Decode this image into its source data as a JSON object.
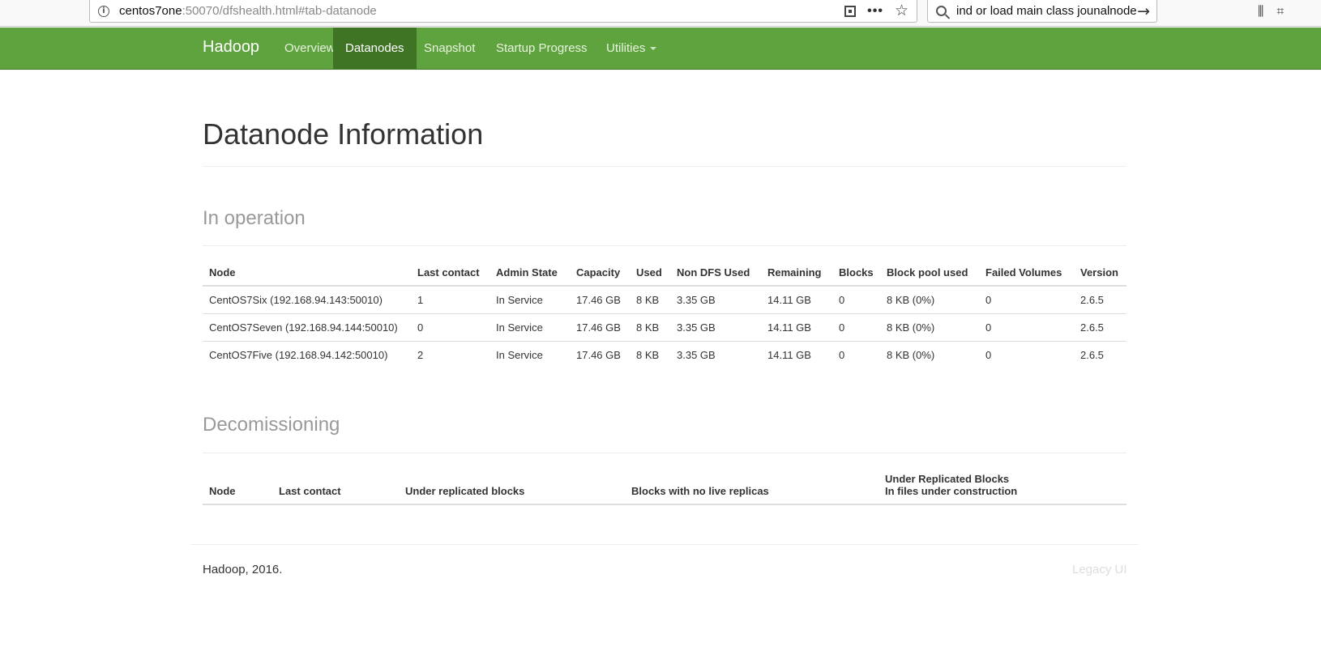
{
  "browser": {
    "url_host": "centos7one",
    "url_rest": ":50070/dfshealth.html#tab-datanode",
    "search_text": "ind or load main class jounalnode"
  },
  "navbar": {
    "brand": "Hadoop",
    "items": [
      {
        "label": "Overview",
        "active": false
      },
      {
        "label": "Datanodes",
        "active": true
      },
      {
        "label": "Snapshot",
        "active": false
      },
      {
        "label": "Startup Progress",
        "active": false
      },
      {
        "label": "Utilities",
        "active": false,
        "dropdown": true
      }
    ],
    "colors": {
      "bar": "#5fa33e",
      "active": "#3e7424"
    }
  },
  "page": {
    "title": "Datanode Information"
  },
  "in_operation": {
    "title": "In operation",
    "columns": [
      "Node",
      "Last contact",
      "Admin State",
      "Capacity",
      "Used",
      "Non DFS Used",
      "Remaining",
      "Blocks",
      "Block pool used",
      "Failed Volumes",
      "Version"
    ],
    "rows": [
      [
        "CentOS7Six (192.168.94.143:50010)",
        "1",
        "In Service",
        "17.46 GB",
        "8 KB",
        "3.35 GB",
        "14.11 GB",
        "0",
        "8 KB (0%)",
        "0",
        "2.6.5"
      ],
      [
        "CentOS7Seven (192.168.94.144:50010)",
        "0",
        "In Service",
        "17.46 GB",
        "8 KB",
        "3.35 GB",
        "14.11 GB",
        "0",
        "8 KB (0%)",
        "0",
        "2.6.5"
      ],
      [
        "CentOS7Five (192.168.94.142:50010)",
        "2",
        "In Service",
        "17.46 GB",
        "8 KB",
        "3.35 GB",
        "14.11 GB",
        "0",
        "8 KB (0%)",
        "0",
        "2.6.5"
      ]
    ]
  },
  "decommissioning": {
    "title": "Decomissioning",
    "columns": [
      "Node",
      "Last contact",
      "Under replicated blocks",
      "Blocks with no live replicas"
    ],
    "last_column_line1": "Under Replicated Blocks",
    "last_column_line2": "In files under construction"
  },
  "footer": {
    "text": "Hadoop, 2016.",
    "legacy_link": "Legacy UI"
  }
}
